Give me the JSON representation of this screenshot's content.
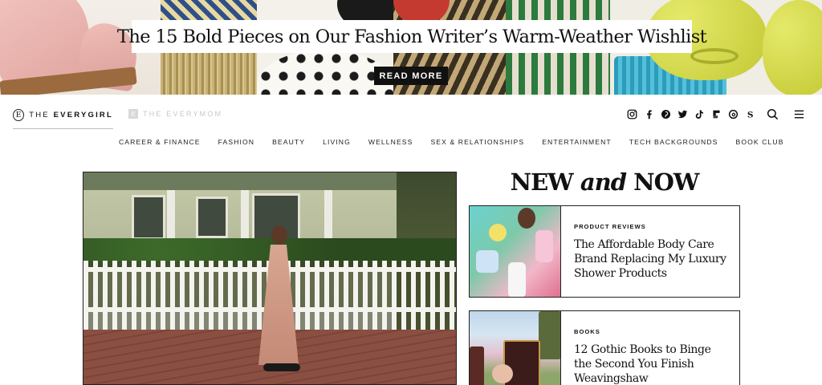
{
  "hero": {
    "title": "The 15 Bold Pieces on Our Fashion Writer’s Warm-Weather Wishlist",
    "cta_label": "READ MORE"
  },
  "header": {
    "logo_letter": "E",
    "logo_main_prefix": "THE ",
    "logo_main_name": "EVERYGIRL",
    "logo_alt_letter": "E",
    "logo_alt": "THE EVERYMOM",
    "social_icons": [
      "instagram-icon",
      "facebook-icon",
      "pinterest-icon",
      "twitter-icon",
      "tiktok-icon",
      "flipboard-icon",
      "threads-icon",
      "substack-icon"
    ],
    "search_icon": "search-icon",
    "menu_icon": "hamburger-menu-icon"
  },
  "nav": {
    "items": [
      "CAREER & FINANCE",
      "FASHION",
      "BEAUTY",
      "LIVING",
      "WELLNESS",
      "SEX & RELATIONSHIPS",
      "ENTERTAINMENT",
      "TECH BACKGROUNDS",
      "BOOK CLUB"
    ]
  },
  "new_and_now": {
    "title_pre": "NEW ",
    "title_italic": "and",
    "title_post": " NOW",
    "cards": [
      {
        "category": "PRODUCT REVIEWS",
        "title": "The Affordable Body Care Brand Replacing My Luxury Shower Products"
      },
      {
        "category": "BOOKS",
        "title": "12 Gothic Books to Binge the Second You Finish Weavingshaw"
      }
    ]
  },
  "colors": {
    "text": "#111111",
    "muted_logo": "#c8c8c8",
    "button_bg": "#111111",
    "button_text": "#ffffff"
  }
}
